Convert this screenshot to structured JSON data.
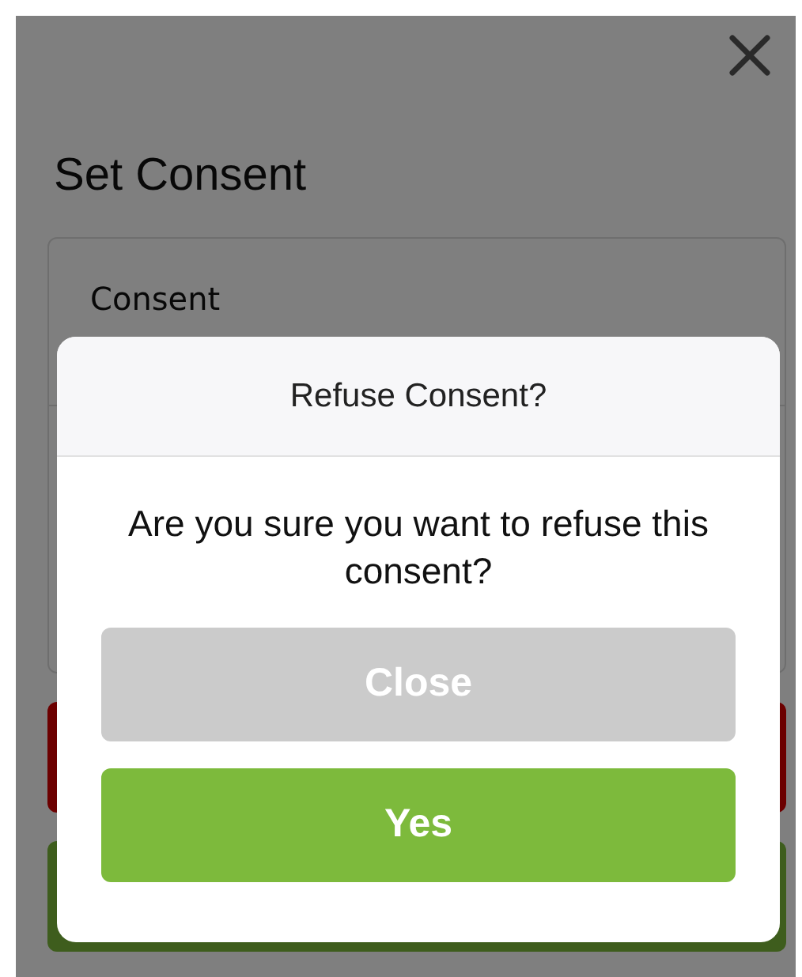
{
  "page": {
    "title": "Set Consent",
    "card": {
      "label": "Consent"
    },
    "actions": [
      {
        "kind": "danger"
      },
      {
        "kind": "success"
      }
    ]
  },
  "dialog": {
    "title": "Refuse Consent?",
    "message": "Are you sure you want to refuse this consent?",
    "buttons": [
      {
        "label": "Close",
        "kind": "secondary"
      },
      {
        "label": "Yes",
        "kind": "primary"
      }
    ]
  }
}
